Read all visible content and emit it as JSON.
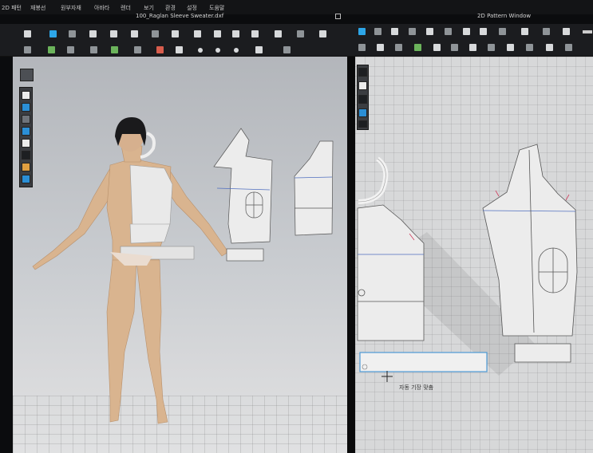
{
  "menu": {
    "items": [
      "2D 패턴",
      "재봉선",
      "원부자재",
      "아바타",
      "렌더",
      "보기",
      "환경",
      "설정",
      "도움말"
    ]
  },
  "windows": {
    "main_title": "100_Raglan Sleeve Sweater.dxf",
    "pattern_title": "2D Pattern Window"
  },
  "status": {
    "tooltip": "자동 기장 맞춤"
  },
  "colors": {
    "accent": "#2da6e8",
    "pattern_fill": "#e6e6e6",
    "seam_blue": "#4f6ebf",
    "notch_red": "#cf3d5d"
  },
  "icons": {
    "toolbar_3d_row1": [
      "move-icon",
      "transform-icon",
      "select-icon",
      "fold-icon",
      "pin-icon",
      "tack-icon",
      "arrange-icon",
      "avatar-icon",
      "simulate-icon",
      "measure-icon"
    ],
    "toolbar_2d_row1": [
      "edit-pattern-icon",
      "add-point-icon",
      "segment-icon",
      "rectangle-icon",
      "ellipse-icon",
      "internal-line-icon",
      "grade-icon",
      "seam-icon"
    ],
    "side_tools": [
      "camera-icon",
      "view-front-icon",
      "view-back-icon",
      "view-left-icon",
      "view-right-icon",
      "texture-icon",
      "avatar-skin-icon",
      "render-icon"
    ],
    "pattern_side_tools": [
      "pen-icon",
      "point-icon",
      "info-icon",
      "fabric-icon",
      "lock-icon"
    ],
    "cursor": "move-cursor-icon"
  }
}
